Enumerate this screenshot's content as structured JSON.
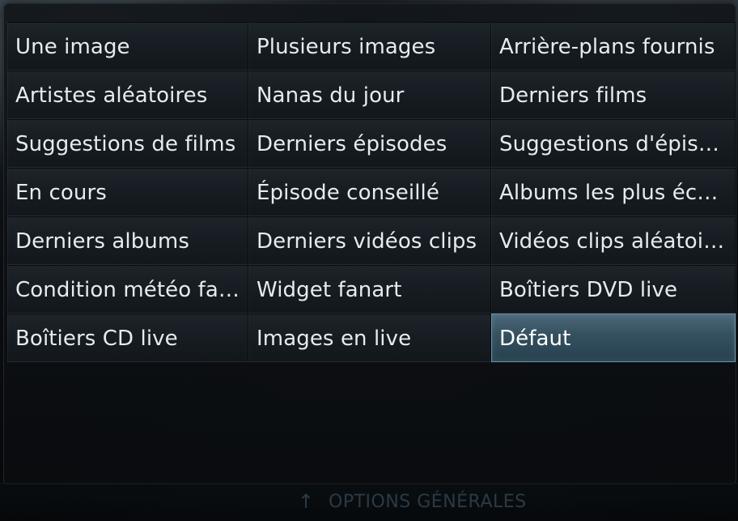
{
  "menu": {
    "items": [
      {
        "label": "Une image"
      },
      {
        "label": "Plusieurs images"
      },
      {
        "label": "Arrière-plans fournis"
      },
      {
        "label": "Artistes aléatoires"
      },
      {
        "label": "Nanas du jour"
      },
      {
        "label": "Derniers films"
      },
      {
        "label": "Suggestions de films"
      },
      {
        "label": "Derniers épisodes"
      },
      {
        "label": "Suggestions d'épisod..."
      },
      {
        "label": "En cours"
      },
      {
        "label": "Épisode conseillé"
      },
      {
        "label": "Albums les plus écou..."
      },
      {
        "label": "Derniers albums"
      },
      {
        "label": "Derniers vidéos clips"
      },
      {
        "label": "Vidéos clips aléatoires"
      },
      {
        "label": "Condition météo fana..."
      },
      {
        "label": "Widget fanart"
      },
      {
        "label": "Boîtiers DVD live"
      },
      {
        "label": "Boîtiers CD live"
      },
      {
        "label": "Images en live"
      },
      {
        "label": "Défaut",
        "selected": true
      }
    ]
  },
  "footer": {
    "arrow_icon": "arrow-up-icon",
    "label": "OPTIONS GÉNÉRALES"
  },
  "colors": {
    "selected_background": "#34505f",
    "selected_border": "#6f8fa2",
    "text": "#e6ebee"
  }
}
